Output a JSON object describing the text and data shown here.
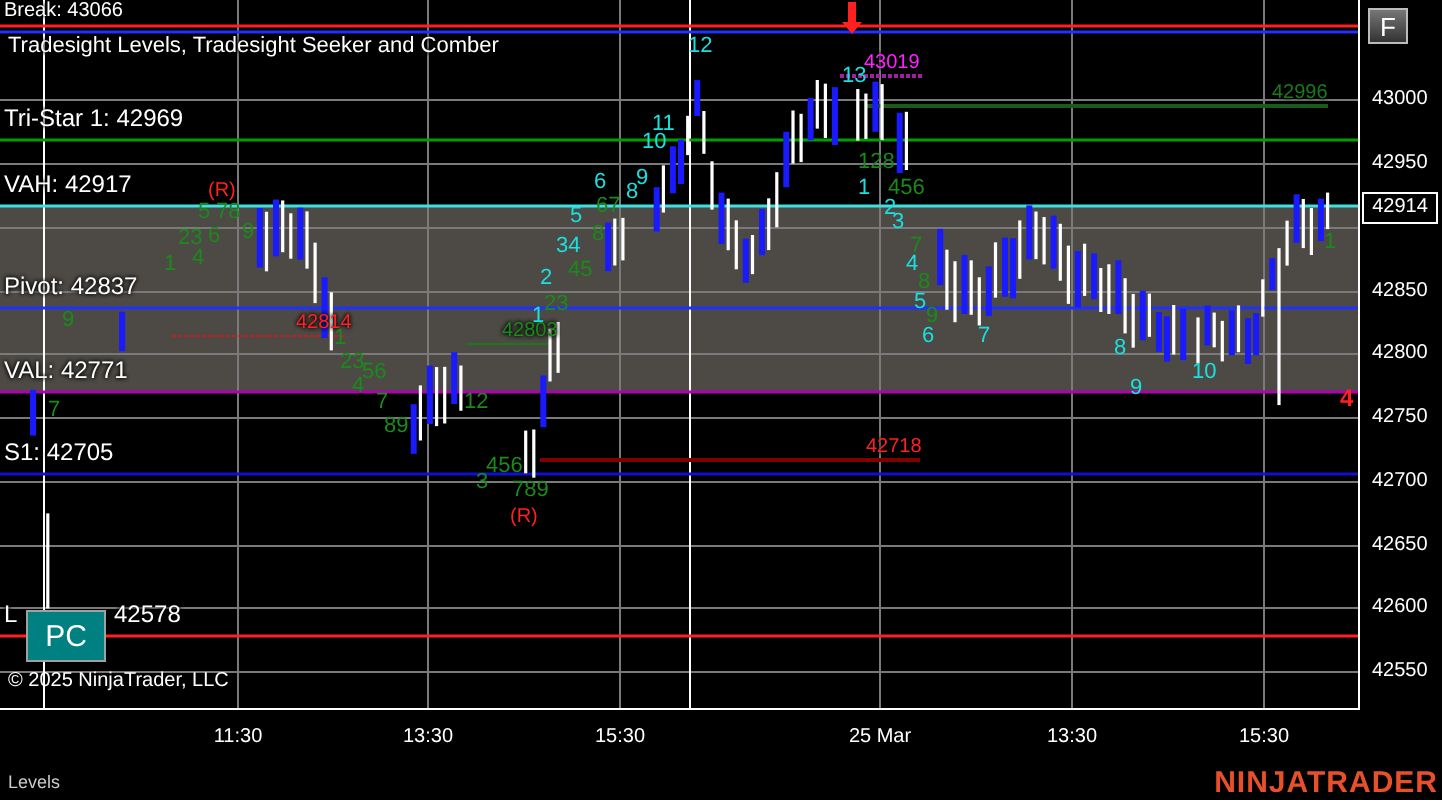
{
  "chart": {
    "title": "Tradesight Levels, Tradesight Seeker and Comber",
    "levels": [
      {
        "kind": "break",
        "text": "Break: 43066"
      },
      {
        "kind": "tristar",
        "text": "Tri-Star 1: 42969"
      },
      {
        "kind": "vah",
        "text": "VAH: 42917"
      },
      {
        "kind": "pivot",
        "text": "Pivot: 42837"
      },
      {
        "kind": "val",
        "text": "VAL: 42771"
      },
      {
        "kind": "s1",
        "text": "S1: 42705"
      },
      {
        "kind": "low",
        "text": "L",
        "text_2": "42578"
      }
    ],
    "price_markers": [
      {
        "kind": "high",
        "text": "43019"
      },
      {
        "kind": "target",
        "text": "42996"
      },
      {
        "kind": "resist",
        "text": "42814"
      },
      {
        "kind": "support",
        "text": "42803"
      },
      {
        "kind": "stop",
        "text": "42718"
      }
    ],
    "reversal_marks": [
      "(R)",
      "(R)"
    ],
    "counts": [
      {
        "text": "12",
        "color": "#19e0e0"
      },
      {
        "text": "11",
        "color": "#19e0e0"
      },
      {
        "text": "10",
        "color": "#19e0e0"
      },
      {
        "text": "9",
        "color": "#19e0e0"
      },
      {
        "text": "8",
        "color": "#19e0e0"
      },
      {
        "text": "6",
        "color": "#19e0e0"
      },
      {
        "text": "5",
        "color": "#19e0e0"
      },
      {
        "text": "34",
        "color": "#19e0e0"
      },
      {
        "text": "2",
        "color": "#19e0e0"
      },
      {
        "text": "1",
        "color": "#19e0e0"
      },
      {
        "text": "13",
        "color": "#19e0e0"
      },
      {
        "text": "1",
        "color": "#19e0e0"
      },
      {
        "text": "2",
        "color": "#19e0e0"
      },
      {
        "text": "3",
        "color": "#19e0e0"
      },
      {
        "text": "4",
        "color": "#19e0e0"
      },
      {
        "text": "5",
        "color": "#19e0e0"
      },
      {
        "text": "6",
        "color": "#19e0e0"
      },
      {
        "text": "7",
        "color": "#19e0e0"
      },
      {
        "text": "8",
        "color": "#19e0e0"
      },
      {
        "text": "9",
        "color": "#19e0e0"
      },
      {
        "text": "10",
        "color": "#19e0e0"
      },
      {
        "text": "5",
        "color": "#1a8a1a"
      },
      {
        "text": "78",
        "color": "#1a8a1a"
      },
      {
        "text": "6",
        "color": "#1a8a1a"
      },
      {
        "text": "9",
        "color": "#1a8a1a"
      },
      {
        "text": "1",
        "color": "#1a8a1a"
      },
      {
        "text": "23",
        "color": "#1a8a1a"
      },
      {
        "text": "4",
        "color": "#1a8a1a"
      },
      {
        "text": "9",
        "color": "#1a8a1a"
      },
      {
        "text": "7",
        "color": "#1a8a1a"
      },
      {
        "text": "1",
        "color": "#1a8a1a"
      },
      {
        "text": "23",
        "color": "#1a8a1a"
      },
      {
        "text": "4",
        "color": "#1a8a1a"
      },
      {
        "text": "56",
        "color": "#1a8a1a"
      },
      {
        "text": "7",
        "color": "#1a8a1a"
      },
      {
        "text": "89",
        "color": "#1a8a1a"
      },
      {
        "text": "12",
        "color": "#1a8a1a"
      },
      {
        "text": "3",
        "color": "#1a8a1a"
      },
      {
        "text": "456",
        "color": "#1a8a1a"
      },
      {
        "text": "789",
        "color": "#1a8a1a"
      },
      {
        "text": "67",
        "color": "#1a8a1a"
      },
      {
        "text": "8",
        "color": "#1a8a1a"
      },
      {
        "text": "45",
        "color": "#1a8a1a"
      },
      {
        "text": "23",
        "color": "#1a8a1a"
      },
      {
        "text": "128",
        "color": "#1a8a1a"
      },
      {
        "text": "456",
        "color": "#1a8a1a"
      },
      {
        "text": "7",
        "color": "#1a8a1a"
      },
      {
        "text": "8",
        "color": "#1a8a1a"
      },
      {
        "text": "9",
        "color": "#1a8a1a"
      },
      {
        "text": "1",
        "color": "#1a8a1a"
      }
    ],
    "edge_mark": "4",
    "current_price": "42914",
    "y_ticks": [
      "43000",
      "42950",
      "42850",
      "42800",
      "42750",
      "42700",
      "42650",
      "42600",
      "42550"
    ],
    "x_ticks": [
      "11:30",
      "13:30",
      "15:30",
      "25 Mar",
      "13:30",
      "15:30"
    ],
    "copyright": "© 2025 NinjaTrader, LLC",
    "pc_button": "PC",
    "f_button": "F"
  },
  "footer": {
    "tab": "Levels",
    "logo": "NINJATRADER"
  }
}
